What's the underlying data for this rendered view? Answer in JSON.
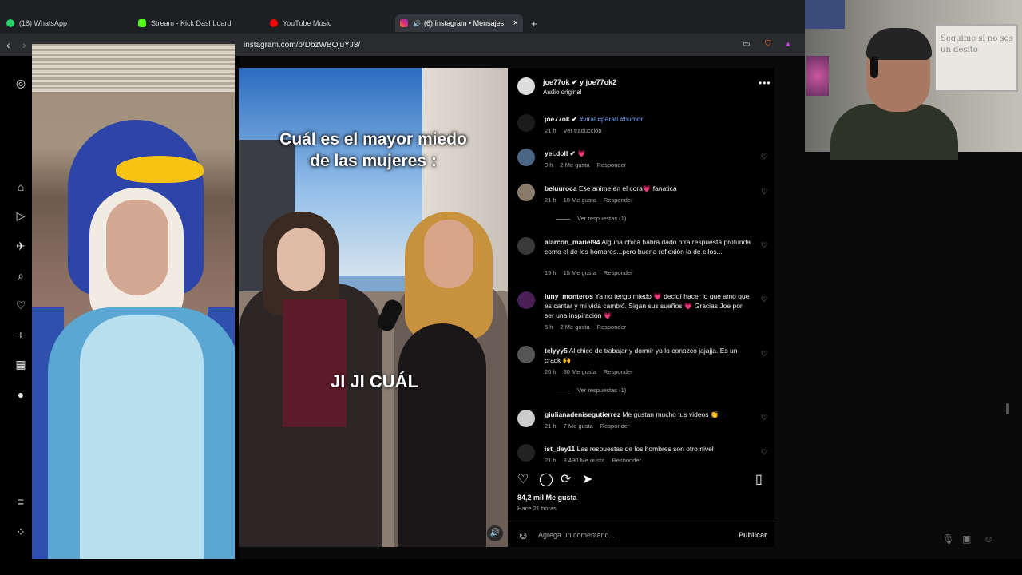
{
  "browser": {
    "tabs": [
      {
        "label": "(18) WhatsApp",
        "color": "#25d366"
      },
      {
        "label": "Stream - Kick Dashboard",
        "color": "#53fc18"
      },
      {
        "label": "YouTube Music",
        "color": "#ff0000"
      },
      {
        "label": "(6) Instagram • Mensajes",
        "color": "#e1306c",
        "active": true
      }
    ],
    "new_tab": "+",
    "close_tab": "×",
    "url": "instagram.com/p/DbzWBOjuYJ3/"
  },
  "video": {
    "caption": "Cuál es el mayor miedo de las mujeres :",
    "subtitle": "JI JI CUÁL"
  },
  "post": {
    "author": "joe77ok",
    "coauthor_line": "joe77ok ✔ y joe77ok2",
    "audio": "Audio original",
    "more": "•••",
    "likes": "84,2 mil Me gusta",
    "ago": "Hace 21 horas",
    "comment_placeholder": "Agrega un comentario...",
    "publish": "Publicar"
  },
  "comments": [
    {
      "user": "joe77ok ✔",
      "text": "#viral #parati #humor",
      "meta": [
        "21 h",
        "Ver traducción"
      ],
      "heart": false,
      "avatar": "#1b1b1b"
    },
    {
      "user": "yei.doll ✔",
      "text": "💗",
      "meta": [
        "9 h",
        "2 Me gusta",
        "Responder"
      ],
      "heart": true,
      "avatar": "#4b6584"
    },
    {
      "user": "beluuroca",
      "text": "Ese anime en el cora💗 fanatica",
      "meta": [
        "21 h",
        "10 Me gusta",
        "Responder"
      ],
      "heart": true,
      "avatar": "#8a7a6a",
      "replies": "Ver respuestas (1)"
    },
    {
      "user": "alarcon_mariel94",
      "text": "Alguna chica habrá dado otra respuesta profunda como el de los hombres...pero buena reflexión la de ellos...",
      "meta": [
        "19 h",
        "15 Me gusta",
        "Responder"
      ],
      "heart": true,
      "avatar": "#3a3a3a"
    },
    {
      "user": "luny_monteros",
      "text": "Ya no tengo miedo 💗 decidí hacer lo que amo que es cantar y mi vida cambió. Sigan sus sueños 💗 Gracias Joe por ser una inspiración 💗",
      "meta": [
        "5 h",
        "2 Me gusta",
        "Responder"
      ],
      "heart": true,
      "avatar": "#4a1f55"
    },
    {
      "user": "telyyy5",
      "text": "Al chico de trabajar y dormir yo lo conozco jajajja. Es un crack 🙌",
      "meta": [
        "20 h",
        "80 Me gusta",
        "Responder"
      ],
      "heart": true,
      "avatar": "#555",
      "replies": "Ver respuestas (1)"
    },
    {
      "user": "giulianadenisegutierrez",
      "text": "Me gustan mucho tus videos 👏",
      "meta": [
        "21 h",
        "7 Me gusta",
        "Responder"
      ],
      "heart": true,
      "avatar": "#ccc"
    },
    {
      "user": "ist_dey11",
      "text": "Las respuestas de los hombres son otro nivel",
      "meta": [
        "21 h",
        "3.490 Me gusta",
        "Responder"
      ],
      "heart": true,
      "avatar": "#222"
    }
  ],
  "webcam": {
    "board_text": "Seguime si no sos un desito"
  }
}
